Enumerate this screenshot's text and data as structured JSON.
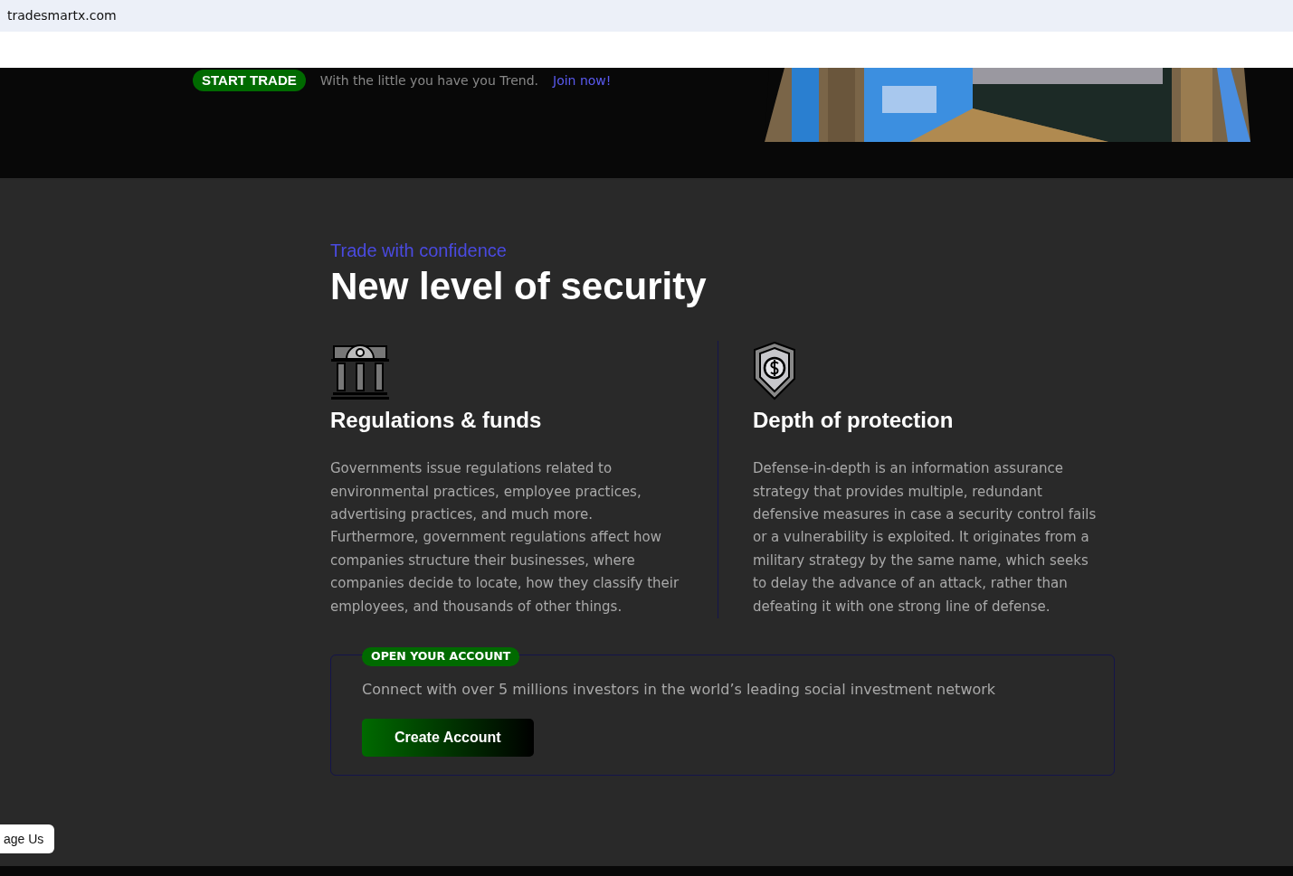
{
  "address_bar": {
    "url": "tradesmartx.com"
  },
  "hero": {
    "badge": "START TRADE",
    "text": "With the little you have you Trend.",
    "link": "Join now!"
  },
  "security": {
    "eyebrow": "Trade with confidence",
    "title": "New level of security",
    "features": [
      {
        "title": "Regulations & funds",
        "text": "Governments issue regulations related to environmental practices, employee practices, advertising practices, and much more. Furthermore, government regulations affect how companies structure their businesses, where companies decide to locate, how they classify their employees, and thousands of other things."
      },
      {
        "title": "Depth of protection",
        "text": "Defense-in-depth is an information assurance strategy that provides multiple, redundant defensive measures in case a security control fails or a vulnerability is exploited. It originates from a military strategy by the same name, which seeks to delay the advance of an attack, rather than defeating it with one strong line of defense."
      }
    ]
  },
  "account": {
    "badge": "OPEN YOUR ACCOUNT",
    "text": "Connect with over 5 millions investors in the world’s leading social investment network",
    "button": "Create Account"
  },
  "floating_button": "age Us"
}
